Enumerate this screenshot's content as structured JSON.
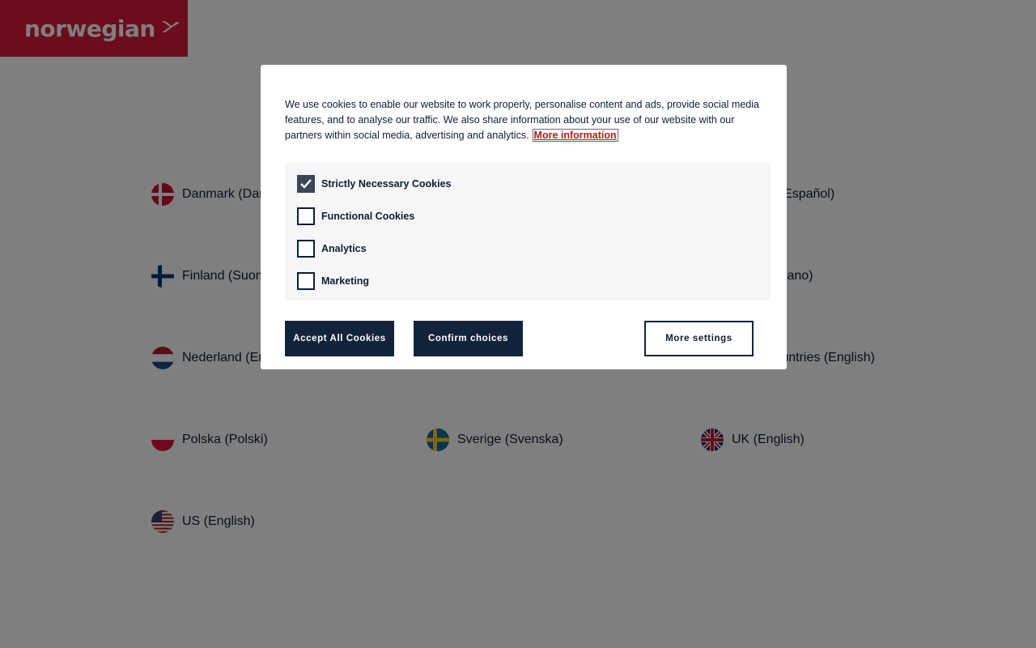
{
  "brand": {
    "logo_text": "norwegian",
    "accent": "#d81939"
  },
  "countries": {
    "danmark": "Danmark (Dansk)",
    "espana": "España (Español)",
    "finland": "Finland (Suomi)",
    "italia": "Italia (Italiano)",
    "nederland": "Nederland (English)",
    "other": "Other countries (English)",
    "polska": "Polska (Polski)",
    "sverige": "Sverige (Svenska)",
    "uk": "UK (English)",
    "us": "US (English)"
  },
  "cookie_dialog": {
    "text": "We use cookies to enable our website to work properly, personalise content and ads, provide social media features, and to analyse our traffic. We also share information about your use of our website with our partners within social media, advertising and analytics.",
    "more_info": "More information",
    "options": [
      {
        "label": "Strictly Necessary Cookies",
        "checked": true
      },
      {
        "label": "Functional Cookies",
        "checked": false
      },
      {
        "label": "Analytics",
        "checked": false
      },
      {
        "label": "Marketing",
        "checked": false
      }
    ],
    "accept_all": "Accept All Cookies",
    "confirm": "Confirm choices",
    "more_settings": "More settings"
  },
  "colors": {
    "button_dark": "#14233c",
    "link_red": "#b21d1d"
  }
}
